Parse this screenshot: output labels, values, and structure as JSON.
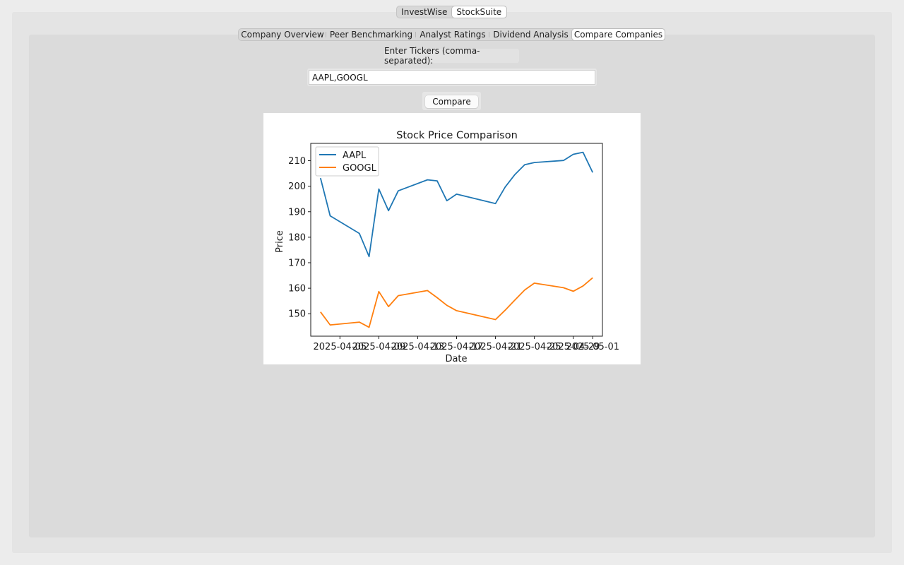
{
  "app_tabs": [
    {
      "label": "InvestWise",
      "active": false
    },
    {
      "label": "StockSuite",
      "active": true
    }
  ],
  "section_tabs": [
    {
      "label": "Company Overview",
      "active": false
    },
    {
      "label": "Peer Benchmarking",
      "active": false
    },
    {
      "label": "Analyst Ratings",
      "active": false
    },
    {
      "label": "Dividend Analysis",
      "active": false
    },
    {
      "label": "Compare Companies",
      "active": true
    }
  ],
  "form": {
    "tickers_label": "Enter Tickers (comma-separated):",
    "tickers_value": "AAPL,GOOGL",
    "compare_label": "Compare"
  },
  "chart_data": {
    "type": "line",
    "title": "Stock Price Comparison",
    "xlabel": "Date",
    "ylabel": "Price",
    "ylim": [
      141.2,
      216.8
    ],
    "yticks": [
      150,
      160,
      170,
      180,
      190,
      200,
      210
    ],
    "xlim": [
      "2025-04-02",
      "2025-05-02"
    ],
    "xticks": [
      "2025-04-05",
      "2025-04-09",
      "2025-04-13",
      "2025-04-17",
      "2025-04-21",
      "2025-04-25",
      "2025-04-29",
      "2025-05-01"
    ],
    "grid": false,
    "legend_position": "upper-left",
    "x": [
      "2025-04-03",
      "2025-04-04",
      "2025-04-07",
      "2025-04-08",
      "2025-04-09",
      "2025-04-10",
      "2025-04-11",
      "2025-04-14",
      "2025-04-15",
      "2025-04-16",
      "2025-04-17",
      "2025-04-21",
      "2025-04-22",
      "2025-04-23",
      "2025-04-24",
      "2025-04-25",
      "2025-04-28",
      "2025-04-29",
      "2025-04-30",
      "2025-05-01"
    ],
    "series": [
      {
        "name": "AAPL",
        "color": "#1f77b4",
        "values": [
          203.2,
          188.4,
          181.5,
          172.4,
          198.9,
          190.4,
          198.2,
          202.5,
          202.1,
          194.3,
          196.9,
          193.2,
          199.7,
          204.6,
          208.4,
          209.3,
          210.1,
          212.5,
          213.3,
          205.4
        ]
      },
      {
        "name": "GOOGL",
        "color": "#ff7f0e",
        "values": [
          150.7,
          145.6,
          146.7,
          144.7,
          158.7,
          152.8,
          157.1,
          159.1,
          156.3,
          153.3,
          151.2,
          147.7,
          151.4,
          155.4,
          159.3,
          162.0,
          160.2,
          158.8,
          160.9,
          164.1
        ]
      }
    ]
  }
}
